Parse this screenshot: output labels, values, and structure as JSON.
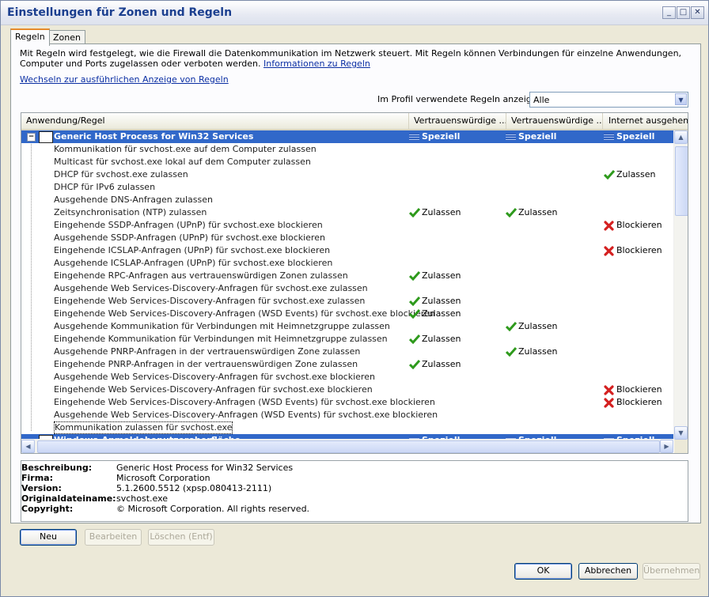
{
  "window": {
    "title": "Einstellungen für Zonen und Regeln",
    "controls": [
      "_",
      "□",
      "✕"
    ]
  },
  "tabs": [
    {
      "label": "Regeln",
      "active": true
    },
    {
      "label": "Zonen",
      "active": false
    }
  ],
  "intro": {
    "text": "Mit Regeln wird festgelegt, wie die Firewall die Datenkommunikation im Netzwerk steuert. Mit Regeln können Verbindungen für einzelne Anwendungen, Computer und Ports zugelassen oder verboten werden. ",
    "link": "Informationen zu Regeln"
  },
  "switch_link": "Wechseln zur ausführlichen Anzeige von Regeln",
  "profile": {
    "label": "Im Profil verwendete Regeln anzeigen:",
    "value": "Alle"
  },
  "columns": [
    "Anwendung/Regel",
    "Vertrauenswürdige ...",
    "Vertrauenswürdige ...",
    "Internet ausgehend"
  ],
  "rows": [
    {
      "name": "Generic Host Process for Win32 Services",
      "group": true,
      "c1": "Speziell",
      "c2": "Speziell",
      "c3": "Speziell"
    },
    {
      "name": "Kommunikation für svchost.exe auf dem Computer zulassen"
    },
    {
      "name": "Multicast für svchost.exe lokal auf dem Computer zulassen"
    },
    {
      "name": "DHCP für svchost.exe zulassen",
      "c3": "Zulassen"
    },
    {
      "name": "DHCP für IPv6 zulassen"
    },
    {
      "name": "Ausgehende DNS-Anfragen zulassen"
    },
    {
      "name": "Zeitsynchronisation (NTP) zulassen",
      "c1": "Zulassen",
      "c2": "Zulassen"
    },
    {
      "name": "Eingehende SSDP-Anfragen (UPnP) für svchost.exe blockieren",
      "c3": "Blockieren"
    },
    {
      "name": "Ausgehende SSDP-Anfragen (UPnP) für svchost.exe blockieren"
    },
    {
      "name": "Eingehende ICSLAP-Anfragen (UPnP) für svchost.exe blockieren",
      "c3": "Blockieren"
    },
    {
      "name": "Ausgehende ICSLAP-Anfragen (UPnP) für svchost.exe blockieren"
    },
    {
      "name": "Eingehende RPC-Anfragen aus vertrauenswürdigen Zonen zulassen",
      "c1": "Zulassen"
    },
    {
      "name": "Ausgehende Web Services-Discovery-Anfragen für svchost.exe zulassen"
    },
    {
      "name": "Eingehende Web Services-Discovery-Anfragen für svchost.exe zulassen",
      "c1": "Zulassen"
    },
    {
      "name": "Eingehende Web Services-Discovery-Anfragen (WSD Events) für svchost.exe blockieren",
      "c1": "Zulassen"
    },
    {
      "name": "Ausgehende Kommunikation für Verbindungen mit Heimnetzgruppe zulassen",
      "c2": "Zulassen"
    },
    {
      "name": "Eingehende Kommunikation für Verbindungen mit Heimnetzgruppe zulassen",
      "c1": "Zulassen"
    },
    {
      "name": "Ausgehende PNRP-Anfragen in der vertrauenswürdigen Zone zulassen",
      "c2": "Zulassen"
    },
    {
      "name": "Eingehende PNRP-Anfragen in der vertrauenswürdigen Zone zulassen",
      "c1": "Zulassen"
    },
    {
      "name": "Ausgehende Web Services-Discovery-Anfragen für svchost.exe blockieren"
    },
    {
      "name": "Eingehende Web Services-Discovery-Anfragen für svchost.exe blockieren",
      "c3": "Blockieren"
    },
    {
      "name": "Eingehende Web Services-Discovery-Anfragen (WSD Events) für svchost.exe blockieren",
      "c3": "Blockieren"
    },
    {
      "name": "Ausgehende Web Services-Discovery-Anfragen (WSD Events) für svchost.exe blockieren"
    },
    {
      "name": "Kommunikation zulassen für svchost.exe",
      "boxed": true
    },
    {
      "name": "Windows-Anmeldebenutzeroberfläche",
      "group": true,
      "partial": true,
      "c1": "Speziell",
      "c2": "Speziell",
      "c3": "Speziell"
    }
  ],
  "details": [
    {
      "label": "Beschreibung:",
      "value": "Generic Host Process for Win32 Services"
    },
    {
      "label": "Firma:",
      "value": "Microsoft Corporation"
    },
    {
      "label": "Version:",
      "value": "5.1.2600.5512 (xpsp.080413-2111)"
    },
    {
      "label": "Originaldateiname:",
      "value": "svchost.exe"
    },
    {
      "label": "Copyright:",
      "value": "© Microsoft Corporation. All rights reserved."
    }
  ],
  "buttons": {
    "new": "Neu",
    "edit": "Bearbeiten",
    "delete": "Löschen (Entf)",
    "ok": "OK",
    "cancel": "Abbrechen",
    "apply": "Übernehmen"
  },
  "colors": {
    "selection": "#3168c9",
    "allow": "#2e9a1c",
    "block": "#d42020",
    "link": "#0a2ea3"
  }
}
